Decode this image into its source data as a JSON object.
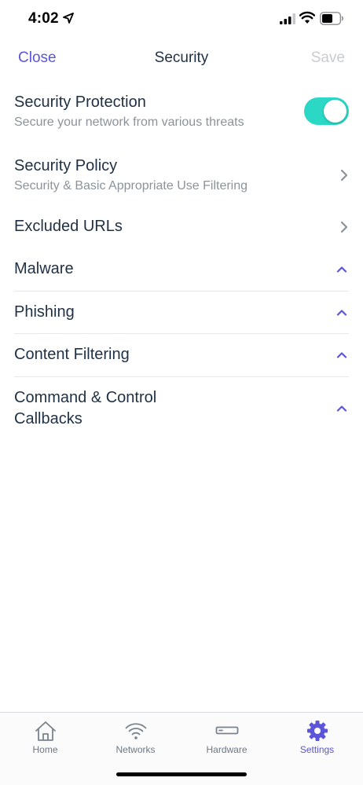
{
  "status_bar": {
    "time": "4:02",
    "icons": [
      "location-arrow-icon",
      "signal-icon",
      "wifi-icon",
      "battery-icon"
    ]
  },
  "nav": {
    "close_label": "Close",
    "title": "Security",
    "save_label": "Save"
  },
  "settings": {
    "protection": {
      "title": "Security Protection",
      "subtitle": "Secure your network from various threats",
      "enabled": true
    },
    "policy": {
      "title": "Security Policy",
      "subtitle": "Security & Basic Appropriate Use Filtering"
    },
    "excluded_urls": {
      "title": "Excluded URLs"
    },
    "sections": [
      {
        "title": "Malware"
      },
      {
        "title": "Phishing"
      },
      {
        "title": "Content Filtering"
      },
      {
        "title_line1": "Command & Control",
        "title_line2": "Callbacks"
      }
    ]
  },
  "tabs": [
    {
      "label": "Home",
      "icon": "home-icon",
      "active": false
    },
    {
      "label": "Networks",
      "icon": "wifi-icon",
      "active": false
    },
    {
      "label": "Hardware",
      "icon": "router-icon",
      "active": false
    },
    {
      "label": "Settings",
      "icon": "gear-icon",
      "active": true
    }
  ],
  "colors": {
    "accent": "#5b55d9",
    "toggle_on": "#2bd8c6",
    "text_primary": "#1f3044",
    "text_secondary": "#8c939b",
    "disabled": "#c8ccd1"
  }
}
